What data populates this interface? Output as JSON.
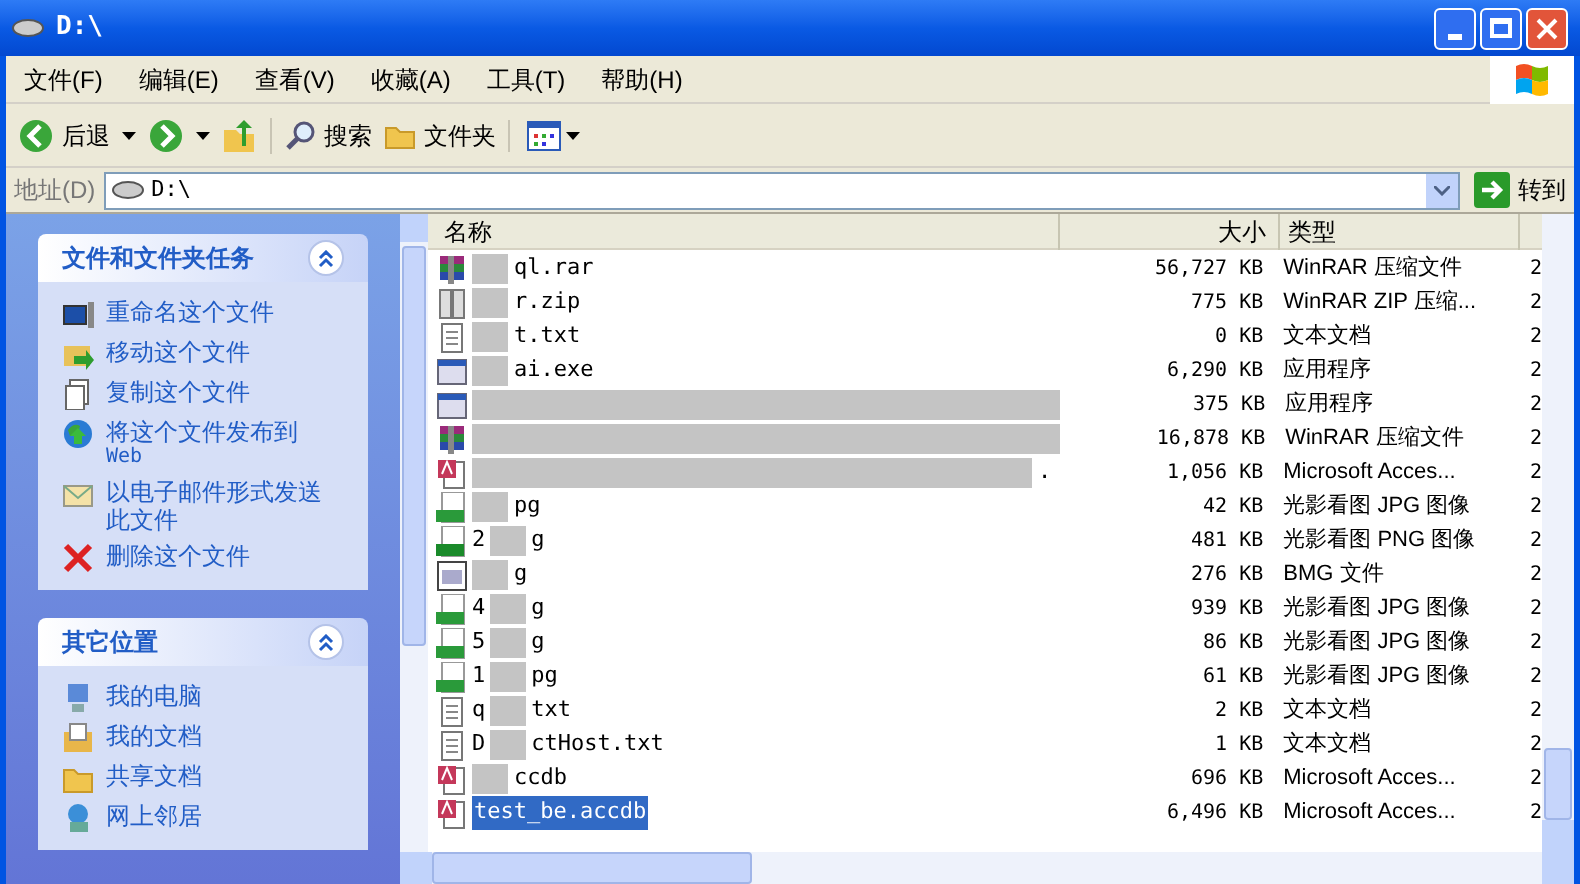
{
  "window": {
    "title": "D:\\"
  },
  "menu": [
    "文件(F)",
    "编辑(E)",
    "查看(V)",
    "收藏(A)",
    "工具(T)",
    "帮助(H)"
  ],
  "toolbar": [
    {
      "kind": "back",
      "label": "后退"
    },
    {
      "kind": "forward"
    },
    {
      "kind": "up"
    },
    {
      "kind": "search",
      "label": "搜索"
    },
    {
      "kind": "folders",
      "label": "文件夹"
    },
    {
      "kind": "views"
    }
  ],
  "address": {
    "label": "地址(D)",
    "value": "D:\\",
    "go": "转到"
  },
  "panels": [
    {
      "title": "文件和文件夹任务",
      "expanded": true,
      "items": [
        {
          "kind": "rename",
          "label": "重命名这个文件"
        },
        {
          "kind": "move",
          "label": "移动这个文件"
        },
        {
          "kind": "copy",
          "label": "复制这个文件"
        },
        {
          "kind": "web",
          "label": "将这个文件发布到",
          "sub": "Web"
        },
        {
          "kind": "mail",
          "label": "以电子邮件形式发送此文件"
        },
        {
          "kind": "delete",
          "label": "删除这个文件"
        }
      ]
    },
    {
      "title": "其它位置",
      "expanded": true,
      "items": [
        {
          "kind": "computer",
          "label": "我的电脑"
        },
        {
          "kind": "docs",
          "label": "我的文档"
        },
        {
          "kind": "folder",
          "label": "共享文档"
        },
        {
          "kind": "network",
          "label": "网上邻居"
        }
      ]
    }
  ],
  "columns": [
    "名称",
    "大小",
    "类型"
  ],
  "rows": [
    {
      "kind": "rar",
      "name": "ql.rar",
      "size": "56,727 KB",
      "type": "WinRAR 压缩文件",
      "column_4": "2",
      "selected": false
    },
    {
      "kind": "zip",
      "name": "r.zip",
      "size": "775 KB",
      "type": "WinRAR ZIP 压缩...",
      "column_4": "2",
      "selected": false
    },
    {
      "kind": "txt",
      "name": "t.txt",
      "size": "0 KB",
      "type": "文本文档",
      "column_4": "2",
      "selected": false
    },
    {
      "kind": "exe",
      "name": "ai.exe",
      "size": "6,290 KB",
      "type": "应用程序",
      "column_4": "2",
      "selected": false
    },
    {
      "kind": "exe",
      "size": "375 KB",
      "type": "应用程序",
      "column_4": "2",
      "selected": false
    },
    {
      "kind": "rar",
      "size": "16,878 KB",
      "type": "WinRAR 压缩文件",
      "column_4": "2",
      "selected": false
    },
    {
      "kind": "accdb",
      "name": ".",
      "size": "1,056 KB",
      "type": "Microsoft Acces...",
      "column_4": "2",
      "selected": false
    },
    {
      "kind": "jpg",
      "name": "pg",
      "size": "42 KB",
      "type": "光影看图 JPG 图像",
      "column_4": "2",
      "selected": false
    },
    {
      "kind": "png",
      "prefix": "2",
      "name": "g",
      "size": "481 KB",
      "type": "光影看图 PNG 图像",
      "column_4": "2",
      "selected": false
    },
    {
      "kind": "bmg",
      "name": "g",
      "size": "276 KB",
      "type": "BMG 文件",
      "column_4": "2",
      "selected": false
    },
    {
      "kind": "jpg",
      "prefix": "4",
      "name": "g",
      "size": "939 KB",
      "type": "光影看图 JPG 图像",
      "column_4": "2",
      "selected": false
    },
    {
      "kind": "jpg",
      "prefix": "5",
      "name": "g",
      "size": "86 KB",
      "type": "光影看图 JPG 图像",
      "column_4": "2",
      "selected": false
    },
    {
      "kind": "jpg",
      "prefix": "1",
      "name": "pg",
      "size": "61 KB",
      "type": "光影看图 JPG 图像",
      "column_4": "2",
      "selected": false
    },
    {
      "kind": "txt",
      "prefix": "q",
      "name": "txt",
      "size": "2 KB",
      "type": "文本文档",
      "column_4": "2",
      "selected": false
    },
    {
      "kind": "txt",
      "prefix": "D",
      "name": "ctHost.txt",
      "size": "1 KB",
      "type": "文本文档",
      "column_4": "2",
      "selected": false
    },
    {
      "kind": "accdb",
      "name": "ccdb",
      "size": "696 KB",
      "type": "Microsoft Acces...",
      "column_4": "2",
      "selected": false
    },
    {
      "kind": "accdb",
      "name": "test_be.accdb",
      "size": "6,496 KB",
      "type": "Microsoft Acces...",
      "column_4": "2",
      "selected": true
    }
  ]
}
